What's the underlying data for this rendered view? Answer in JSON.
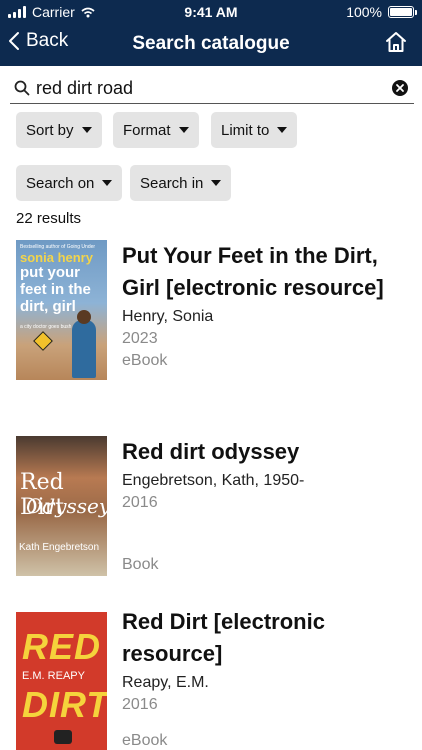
{
  "status_bar": {
    "carrier": "Carrier",
    "time": "9:41 AM",
    "battery": "100%"
  },
  "nav": {
    "back_label": "Back",
    "title": "Search catalogue"
  },
  "search": {
    "value": "red dirt road",
    "placeholder": ""
  },
  "filters": [
    {
      "label": "Sort by"
    },
    {
      "label": "Format"
    },
    {
      "label": "Limit to"
    },
    {
      "label": "Search on"
    },
    {
      "label": "Search in"
    }
  ],
  "results_count": "22 results",
  "results": [
    {
      "title": "Put Your Feet in the Dirt, Girl [electronic resource]",
      "author": "Henry, Sonia",
      "year": "2023",
      "format": "eBook",
      "cover": {
        "top_text": "Bestselling author of Going Under",
        "author": "sonia henry",
        "title": "put your feet in the dirt, girl",
        "subtitle": "a city doctor goes bush",
        "bg": "#5a7fa8"
      }
    },
    {
      "title": "Red dirt odyssey",
      "author": "Engebretson, Kath, 1950-",
      "year": "2016",
      "format": "Book",
      "cover": {
        "title_line1": "Red Dirt",
        "title_line2": "Odyssey",
        "author": "Kath Engebretson",
        "bg": "#8a5a3c"
      }
    },
    {
      "title": "Red Dirt [electronic resource]",
      "author": "Reapy, E.M.",
      "year": "2016",
      "format": "eBook",
      "cover": {
        "title_line1": "RED",
        "author": "E.M. REAPY",
        "title_line2": "DIRT",
        "bg": "#d23a2a"
      }
    }
  ],
  "colors": {
    "navbar": "#0d2a4f",
    "chip": "#e4e4e4",
    "muted_text": "#8a8a8a"
  }
}
